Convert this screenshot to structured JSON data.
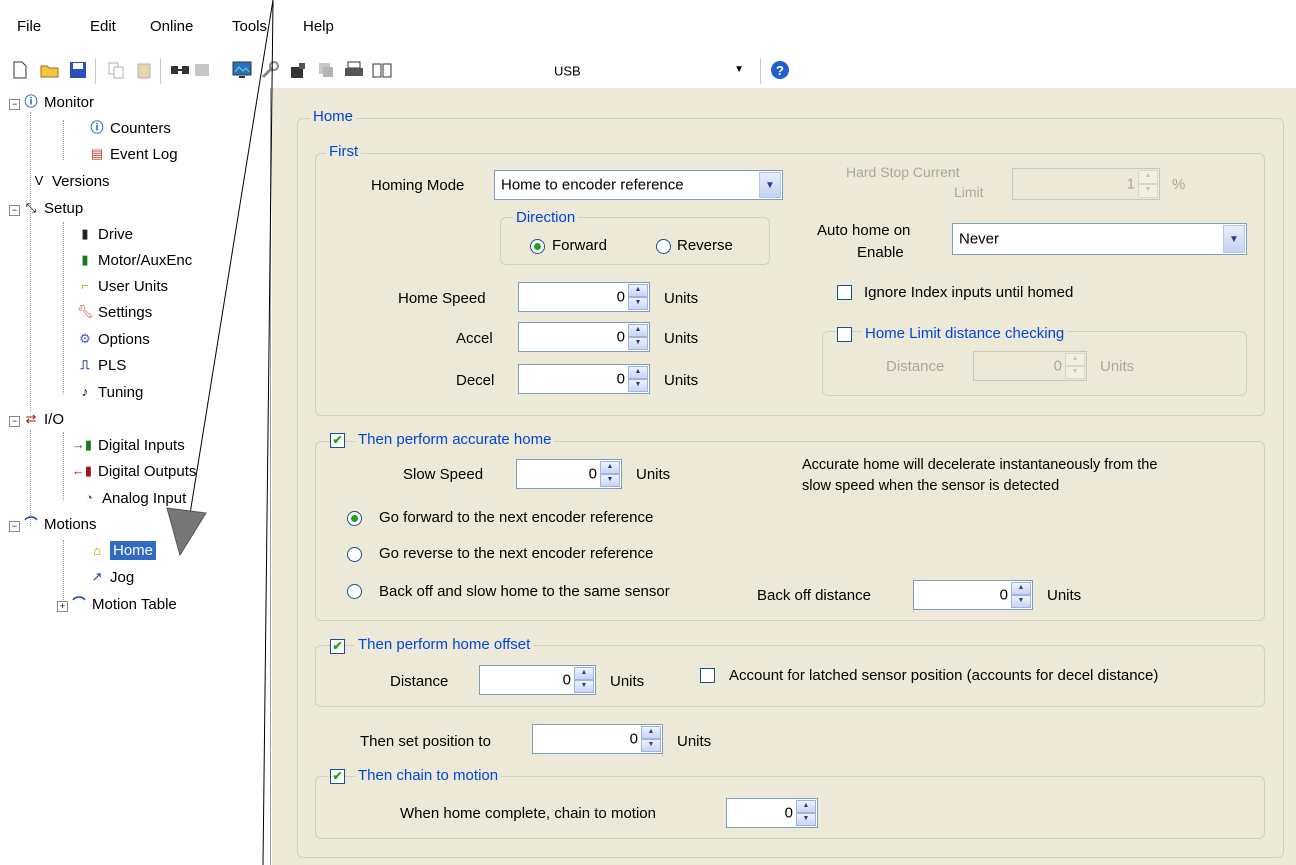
{
  "menu": [
    "File",
    "Edit",
    "Online",
    "Tools",
    "Help"
  ],
  "toolbar": {
    "connection_value": "USB",
    "icons": [
      "new-file-icon",
      "open-folder-icon",
      "save-icon",
      "copy-icon",
      "paste-icon",
      "connect-icon",
      "module-icon",
      "monitor-icon",
      "wrench-icon",
      "upload-icon",
      "download-icon",
      "printer-icon",
      "book-icon",
      "help-icon"
    ]
  },
  "tree": {
    "monitor": "Monitor",
    "counters": "Counters",
    "event_log": "Event Log",
    "versions": "Versions",
    "setup": "Setup",
    "drive": "Drive",
    "motor": "Motor/AuxEnc",
    "user_units": "User Units",
    "settings": "Settings",
    "options": "Options",
    "pls": "PLS",
    "tuning": "Tuning",
    "io": "I/O",
    "digital_inputs": "Digital Inputs",
    "digital_outputs": "Digital Outputs",
    "analog_input": "Analog Input",
    "motions": "Motions",
    "home": "Home",
    "jog": "Jog",
    "motion_table": "Motion Table"
  },
  "home": {
    "group_title": "Home",
    "first": {
      "title": "First",
      "homing_mode_label": "Homing Mode",
      "homing_mode_value": "Home to encoder reference",
      "direction_title": "Direction",
      "forward": "Forward",
      "reverse": "Reverse",
      "home_speed_label": "Home Speed",
      "home_speed_value": "0",
      "accel_label": "Accel",
      "accel_value": "0",
      "decel_label": "Decel",
      "decel_value": "0",
      "units": "Units",
      "hard_stop_label_1": "Hard Stop Current",
      "hard_stop_label_2": "Limit",
      "hard_stop_value": "1",
      "percent": "%",
      "auto_home_label_1": "Auto home on",
      "auto_home_label_2": "Enable",
      "auto_home_value": "Never",
      "ignore_index": "Ignore Index inputs until homed",
      "home_limit_check": "Home Limit distance checking",
      "distance_label": "Distance",
      "distance_value": "0"
    },
    "accurate": {
      "title": "Then perform accurate home",
      "slow_speed_label": "Slow Speed",
      "slow_speed_value": "0",
      "note_1": "Accurate home will decelerate instantaneously from the",
      "note_2": "slow speed when the sensor is detected",
      "opt_forward": "Go forward to the next encoder reference",
      "opt_reverse": "Go reverse to the next encoder reference",
      "opt_backoff": "Back off and slow home to the same sensor",
      "backoff_label": "Back off distance",
      "backoff_value": "0"
    },
    "offset": {
      "title": "Then perform home offset",
      "distance_label": "Distance",
      "distance_value": "0",
      "latched": "Account for latched sensor position (accounts for decel distance)"
    },
    "set_position_label": "Then set position to",
    "set_position_value": "0",
    "chain": {
      "title": "Then chain to motion",
      "label": "When home complete, chain to motion",
      "value": "0"
    }
  }
}
